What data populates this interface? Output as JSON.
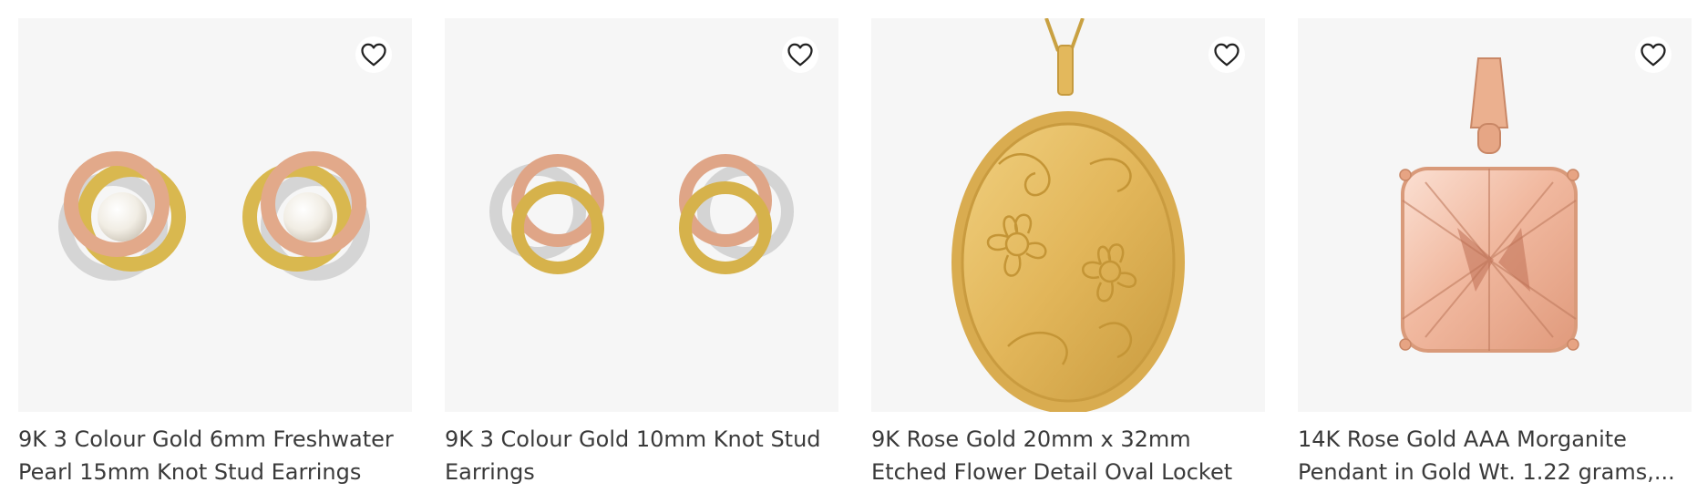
{
  "products": [
    {
      "title": "9K 3 Colour Gold 6mm Freshwater Pearl 15mm Knot Stud Earrings",
      "image": "pearl-knot-stud-earrings",
      "wishlist_icon": "heart-outline-icon"
    },
    {
      "title": "9K 3 Colour Gold 10mm Knot Stud Earrings",
      "image": "knot-stud-earrings",
      "wishlist_icon": "heart-outline-icon"
    },
    {
      "title": "9K Rose Gold 20mm x 32mm Etched Flower Detail Oval Locket",
      "image": "oval-locket",
      "wishlist_icon": "heart-outline-icon"
    },
    {
      "title": "14K Rose Gold AAA Morganite Pendant in Gold Wt. 1.22 grams,...",
      "image": "morganite-pendant",
      "wishlist_icon": "heart-outline-icon"
    }
  ],
  "colors": {
    "card_bg": "#f6f6f6",
    "text": "#3a3a3a",
    "yellow_gold": "#d8b04a",
    "rose_gold": "#e3a47f",
    "white_gold": "#d6d6d6"
  }
}
